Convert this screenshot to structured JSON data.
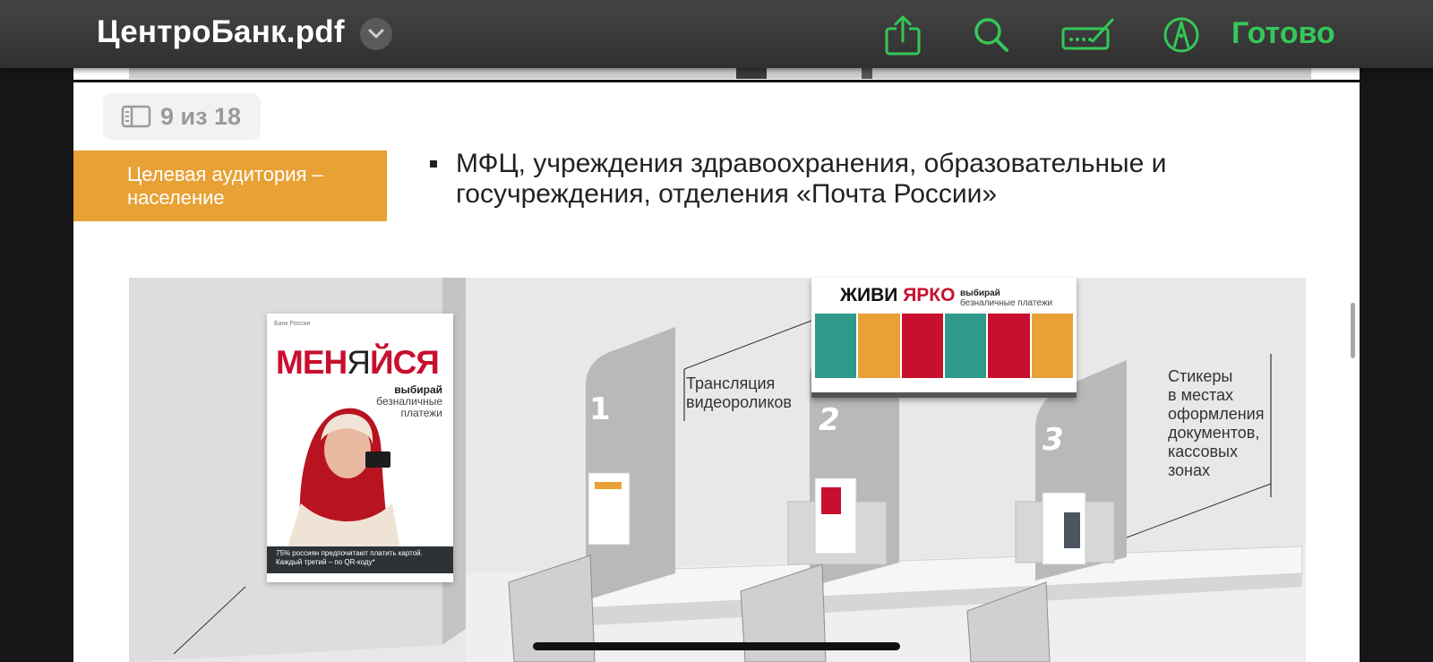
{
  "toolbar": {
    "document_title": "ЦентроБанк.pdf",
    "done_label": "Готово",
    "accent_color": "#35c759",
    "icons": [
      "chevron-down-icon",
      "share-icon",
      "search-icon",
      "markup-icon",
      "pen-icon"
    ]
  },
  "page": {
    "indicator_label": "9 из 18",
    "indicator_icon": "sidebar-icon",
    "audience_label": "Целевая аудитория – население",
    "audience_color": "#e7a135",
    "bullet_text": "МФЦ, учреждения здравоохранения, образовательные и госучреждения, отделения «Почта России»"
  },
  "illustration": {
    "window_numbers": [
      "1",
      "2",
      "3"
    ],
    "video_label_line1": "Трансляция",
    "video_label_line2": "видеороликов",
    "stickers_label": [
      "Стикеры",
      "в местах",
      "оформления",
      "документов,",
      "кассовых",
      "зонах"
    ],
    "poster": {
      "logo_text": "Банк России",
      "title_part1": "МЕН",
      "title_part2": "Я",
      "title_part3": "ЙСЯ",
      "choose": "выбирай",
      "subtitle": "безналичные платежи",
      "footer": "75% россиян предпочитают платить картой. Каждый третий – по QR-коду*"
    },
    "banner": {
      "title_part1": "ЖИВИ",
      "title_part2": "ЯРКО",
      "choose": "выбирай",
      "subtitle": "безналичные платежи",
      "photo_backgrounds": [
        "#2f9a8a",
        "#e7a135",
        "#c8102e",
        "#2f9a8a",
        "#c8102e",
        "#e7a135"
      ]
    }
  }
}
